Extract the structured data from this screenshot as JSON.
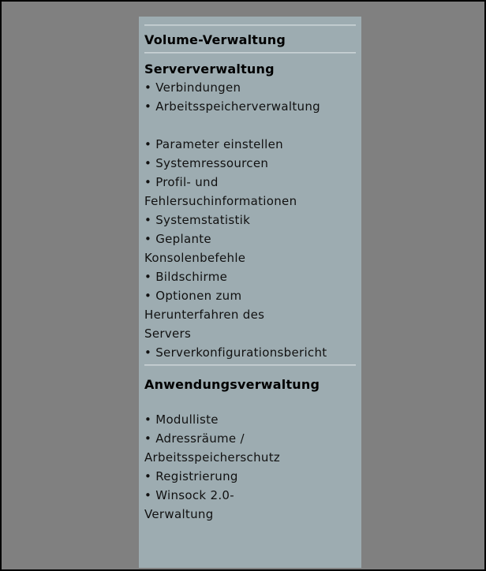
{
  "menu": {
    "volume_title": "Volume-Verwaltung",
    "server_title": "Serververwaltung",
    "server_items": [
      "• Verbindungen",
      "• Arbeitsspeicherverwaltung",
      "• Parameter einstellen",
      "• Systemressourcen",
      "• Profil- und",
      "Fehlersuchinformationen",
      "• Systemstatistik",
      "• Geplante",
      "Konsolenbefehle",
      "• Bildschirme",
      "• Optionen zum",
      "Herunterfahren des",
      "Servers",
      "• Serverkonfigurationsbericht"
    ],
    "app_title": "Anwendungsverwaltung",
    "app_items": [
      "• Modulliste",
      "• Adressräume /",
      "Arbeitsspeicherschutz",
      "• Registrierung",
      "• Winsock 2.0-",
      "Verwaltung"
    ]
  }
}
